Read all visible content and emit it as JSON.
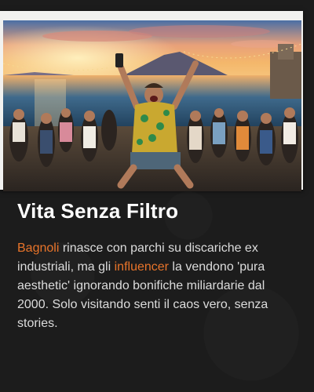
{
  "article": {
    "title": "Vita Senza Filtro",
    "image_alt": "Crowd celebrating on a beach promenade at sunset",
    "paragraph": {
      "link1": "Bagnoli",
      "text1": " rinasce con parchi su discariche ex industriali, ma gli ",
      "link2": "influencer",
      "text2": " la vendono 'pura aesthetic' ignorando bonifiche miliardarie dal 2000. Solo visitando senti il caos vero, senza stories."
    }
  },
  "colors": {
    "background": "#1c1c1c",
    "link": "#e8742a",
    "title": "#ffffff",
    "text": "#dcdcdc"
  }
}
